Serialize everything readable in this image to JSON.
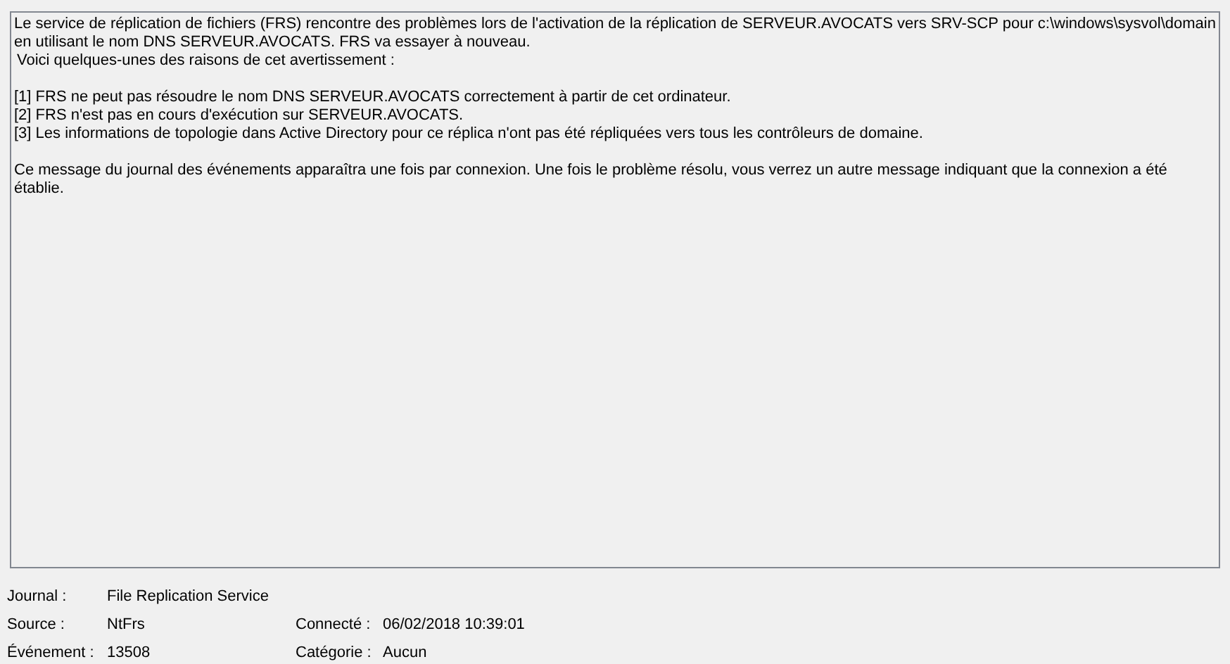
{
  "message": {
    "paragraphs": [
      [
        "Le service de réplication de fichiers (FRS) rencontre des problèmes lors de l'activation de la réplication de SERVEUR.AVOCATS vers SRV-SCP pour c:\\windows\\sysvol\\domain en utilisant le nom DNS SERVEUR.AVOCATS. FRS va essayer à nouveau.",
        "Voici quelques-unes des raisons de cet avertissement :"
      ],
      [
        "[1] FRS ne peut pas résoudre le nom DNS SERVEUR.AVOCATS correctement à partir de cet ordinateur.",
        "[2] FRS n'est pas en cours d'exécution sur SERVEUR.AVOCATS.",
        "[3] Les informations de topologie dans Active Directory pour ce réplica n'ont pas été répliquées vers tous les contrôleurs de domaine."
      ],
      [
        "Ce message du journal des événements apparaîtra une fois par connexion. Une fois le problème résolu, vous verrez un autre message indiquant que la connexion a été établie."
      ]
    ]
  },
  "details": [
    [
      {
        "label": "Journal :",
        "value": "File Replication Service"
      }
    ],
    [
      {
        "label": "Source :",
        "value": "NtFrs"
      },
      {
        "label": "Connecté :",
        "value": "06/02/2018 10:39:01"
      }
    ],
    [
      {
        "label": "Événement :",
        "value": "13508"
      },
      {
        "label": "Catégorie :",
        "value": "Aucun"
      }
    ]
  ]
}
